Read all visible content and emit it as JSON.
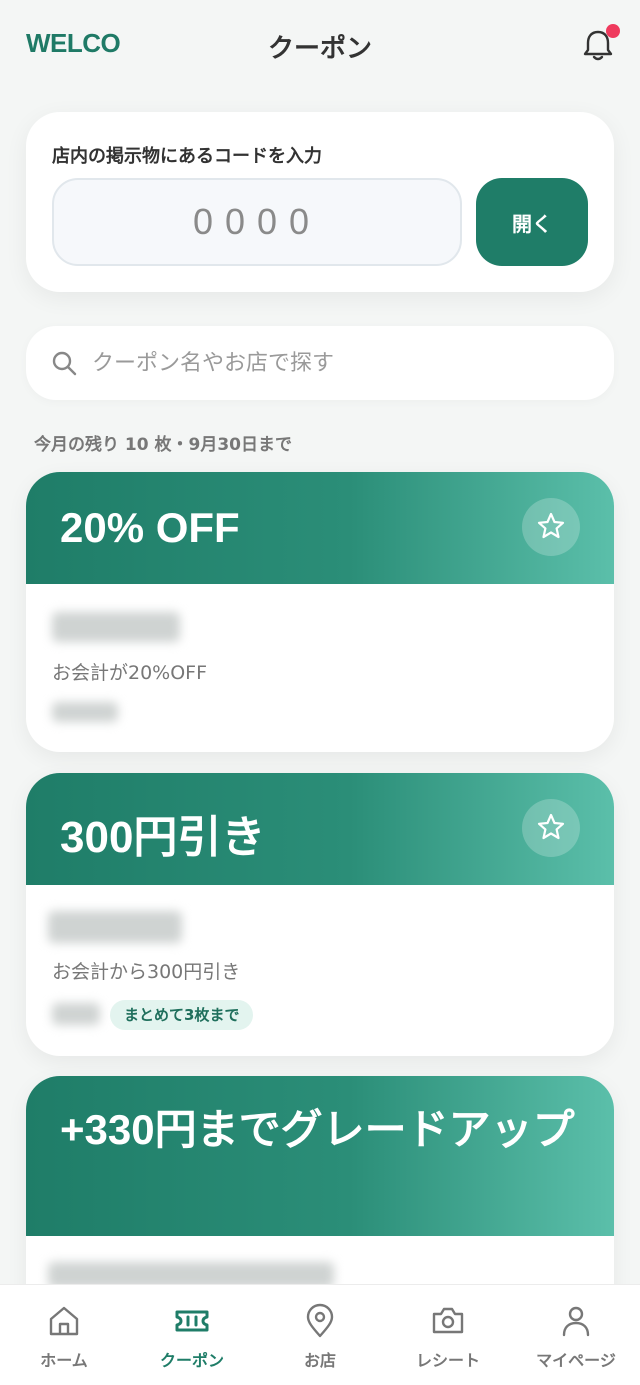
{
  "header": {
    "logo": "WELCO",
    "title": "クーポン",
    "notification_dot_color": "#ef3a5d"
  },
  "code_entry": {
    "label": "店内の掲示物にあるコードを入力",
    "placeholder": "0000",
    "open_button": "開く"
  },
  "search": {
    "placeholder": "クーポン名やお店で探す",
    "icon": "search-icon"
  },
  "remaining_text": "今月の残り 10 枚・9月30日まで",
  "coupons": [
    {
      "title": "20% OFF",
      "description": "お会計が20%OFF",
      "tag": ""
    },
    {
      "title": "300円引き",
      "description": "お会計から300円引き",
      "tag": "まとめて3枚まで"
    },
    {
      "title": "+330円までグレードアップ",
      "description": "",
      "tag": ""
    }
  ],
  "bottom_nav": [
    {
      "label": "ホーム",
      "icon": "home-icon",
      "active": false
    },
    {
      "label": "クーポン",
      "icon": "ticket-icon",
      "active": true
    },
    {
      "label": "お店",
      "icon": "map-pin-icon",
      "active": false
    },
    {
      "label": "レシート",
      "icon": "camera-icon",
      "active": false
    },
    {
      "label": "マイページ",
      "icon": "user-icon",
      "active": false
    }
  ],
  "colors": {
    "brand": "#1f7d68",
    "background": "#f4f6f5",
    "accent_light": "#5bbfaa"
  }
}
